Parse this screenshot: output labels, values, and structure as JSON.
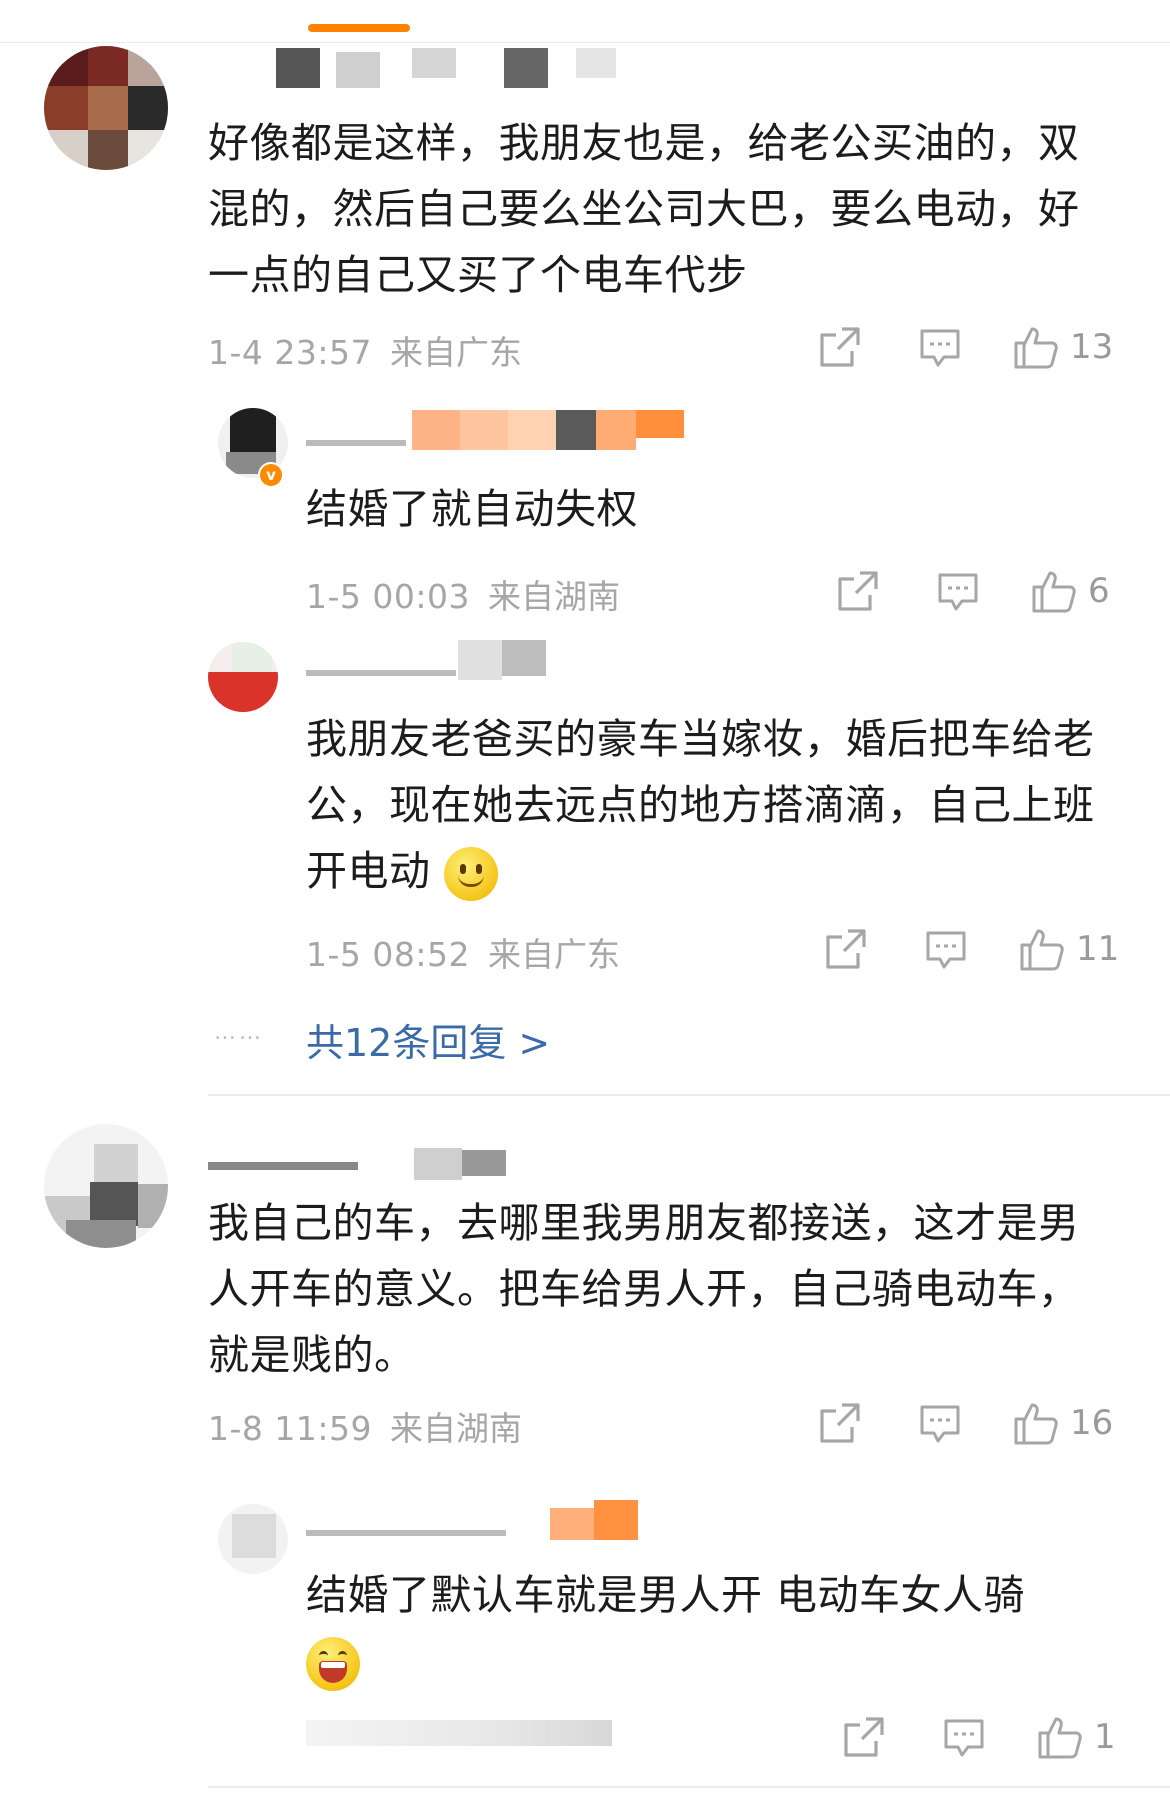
{
  "colors": {
    "accent": "#ff8200",
    "link": "#3a6ba6",
    "meta": "#a6a6a6",
    "text": "#1c1c1c",
    "verified": "#ff8a00"
  },
  "comments": [
    {
      "text": "好像都是这样，我朋友也是，给老公买油的，双混的，然后自己要么坐公司大巴，要么电动，好一点的自己又买了个电车代步",
      "time": "1-4 23:57",
      "location": "来自广东",
      "likes": "13",
      "replies": [
        {
          "text": "结婚了就自动失权",
          "time": "1-5 00:03",
          "location": "来自湖南",
          "likes": "6",
          "badge_icon": "verified-badge-icon"
        },
        {
          "text": "我朋友老爸买的豪车当嫁妆，婚后把车给老公，现在她去远点的地方搭滴滴，自己上班开电动",
          "emoji": "smile-emoji-icon",
          "time": "1-5 08:52",
          "location": "来自广东",
          "likes": "11"
        }
      ],
      "more_replies": "共12条回复 >",
      "more_dots": "……"
    },
    {
      "text": "我自己的车，去哪里我男朋友都接送，这才是男人开车的意义。把车给男人开，自己骑电动车，就是贱的。",
      "time": "1-8 11:59",
      "location": "来自湖南",
      "likes": "16",
      "replies": [
        {
          "text": "结婚了默认车就是男人开 电动车女人骑",
          "emoji": "laugh-emoji-icon",
          "likes": "1"
        }
      ]
    }
  ],
  "icons": {
    "share": "share-icon",
    "comment": "comment-icon",
    "like": "thumbs-up-icon"
  }
}
